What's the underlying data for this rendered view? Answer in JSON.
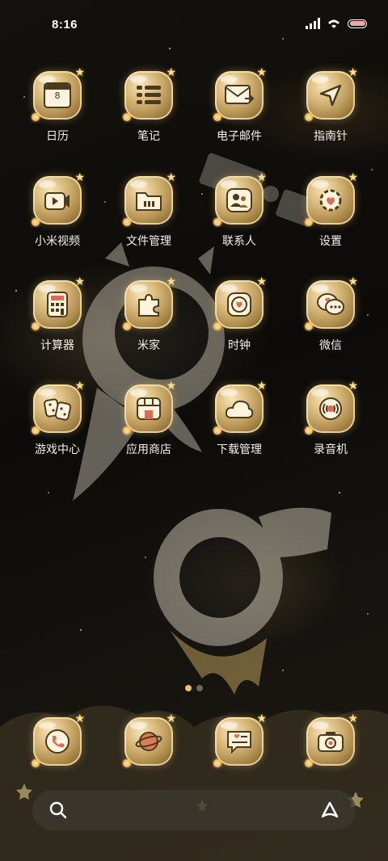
{
  "status_bar": {
    "time": "8:16"
  },
  "apps": [
    {
      "label": "日历",
      "icon": "calendar-icon"
    },
    {
      "label": "笔记",
      "icon": "notes-icon"
    },
    {
      "label": "电子邮件",
      "icon": "mail-icon"
    },
    {
      "label": "指南针",
      "icon": "compass-icon"
    },
    {
      "label": "小米视频",
      "icon": "video-icon"
    },
    {
      "label": "文件管理",
      "icon": "folder-icon"
    },
    {
      "label": "联系人",
      "icon": "contacts-icon"
    },
    {
      "label": "设置",
      "icon": "settings-icon"
    },
    {
      "label": "计算器",
      "icon": "calculator-icon"
    },
    {
      "label": "米家",
      "icon": "puzzle-icon"
    },
    {
      "label": "时钟",
      "icon": "clock-icon"
    },
    {
      "label": "微信",
      "icon": "wechat-icon"
    },
    {
      "label": "游戏中心",
      "icon": "game-icon"
    },
    {
      "label": "应用商店",
      "icon": "store-icon"
    },
    {
      "label": "下载管理",
      "icon": "cloud-icon"
    },
    {
      "label": "录音机",
      "icon": "recorder-icon"
    }
  ],
  "dock": [
    {
      "icon": "phone-icon"
    },
    {
      "icon": "browser-planet-icon"
    },
    {
      "icon": "messages-icon"
    },
    {
      "icon": "camera-icon"
    }
  ],
  "calendar_day": "8",
  "colors": {
    "accent": "#f0c060",
    "label": "#f3f0ea"
  }
}
